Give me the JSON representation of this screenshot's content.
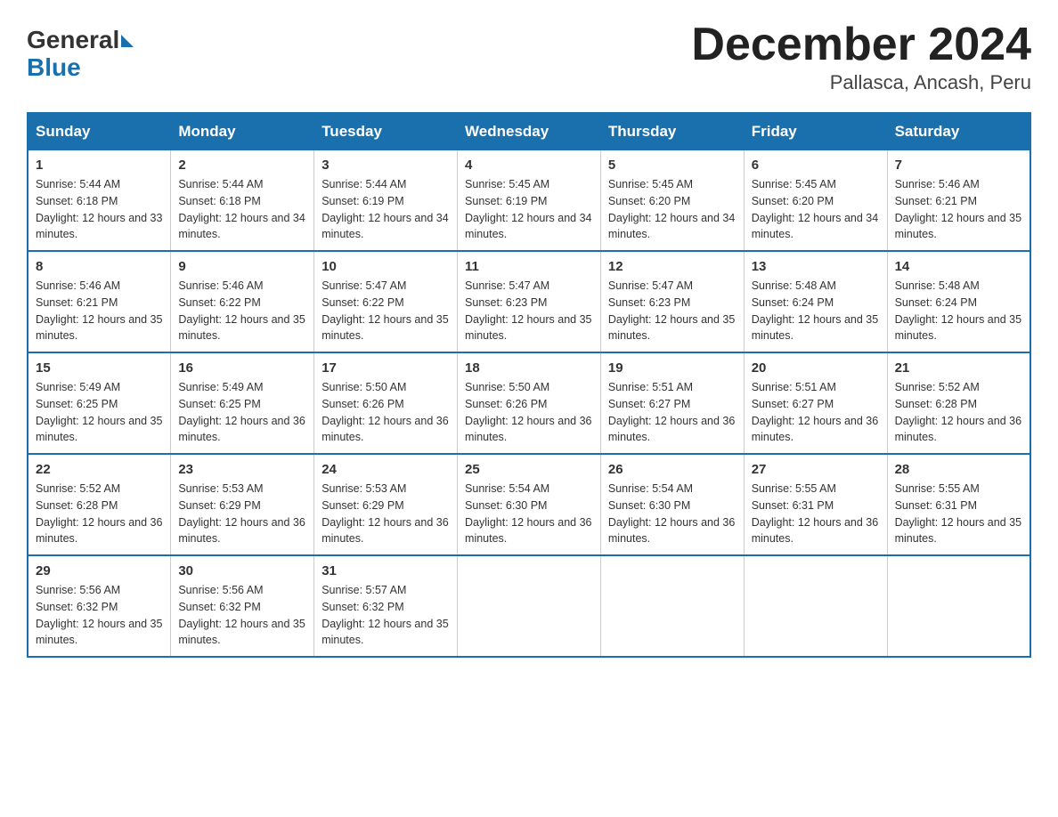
{
  "header": {
    "title": "December 2024",
    "subtitle": "Pallasca, Ancash, Peru"
  },
  "logo": {
    "general": "General",
    "blue": "Blue"
  },
  "days_of_week": [
    "Sunday",
    "Monday",
    "Tuesday",
    "Wednesday",
    "Thursday",
    "Friday",
    "Saturday"
  ],
  "weeks": [
    [
      {
        "day": "1",
        "sunrise": "5:44 AM",
        "sunset": "6:18 PM",
        "daylight": "12 hours and 33 minutes."
      },
      {
        "day": "2",
        "sunrise": "5:44 AM",
        "sunset": "6:18 PM",
        "daylight": "12 hours and 34 minutes."
      },
      {
        "day": "3",
        "sunrise": "5:44 AM",
        "sunset": "6:19 PM",
        "daylight": "12 hours and 34 minutes."
      },
      {
        "day": "4",
        "sunrise": "5:45 AM",
        "sunset": "6:19 PM",
        "daylight": "12 hours and 34 minutes."
      },
      {
        "day": "5",
        "sunrise": "5:45 AM",
        "sunset": "6:20 PM",
        "daylight": "12 hours and 34 minutes."
      },
      {
        "day": "6",
        "sunrise": "5:45 AM",
        "sunset": "6:20 PM",
        "daylight": "12 hours and 34 minutes."
      },
      {
        "day": "7",
        "sunrise": "5:46 AM",
        "sunset": "6:21 PM",
        "daylight": "12 hours and 35 minutes."
      }
    ],
    [
      {
        "day": "8",
        "sunrise": "5:46 AM",
        "sunset": "6:21 PM",
        "daylight": "12 hours and 35 minutes."
      },
      {
        "day": "9",
        "sunrise": "5:46 AM",
        "sunset": "6:22 PM",
        "daylight": "12 hours and 35 minutes."
      },
      {
        "day": "10",
        "sunrise": "5:47 AM",
        "sunset": "6:22 PM",
        "daylight": "12 hours and 35 minutes."
      },
      {
        "day": "11",
        "sunrise": "5:47 AM",
        "sunset": "6:23 PM",
        "daylight": "12 hours and 35 minutes."
      },
      {
        "day": "12",
        "sunrise": "5:47 AM",
        "sunset": "6:23 PM",
        "daylight": "12 hours and 35 minutes."
      },
      {
        "day": "13",
        "sunrise": "5:48 AM",
        "sunset": "6:24 PM",
        "daylight": "12 hours and 35 minutes."
      },
      {
        "day": "14",
        "sunrise": "5:48 AM",
        "sunset": "6:24 PM",
        "daylight": "12 hours and 35 minutes."
      }
    ],
    [
      {
        "day": "15",
        "sunrise": "5:49 AM",
        "sunset": "6:25 PM",
        "daylight": "12 hours and 35 minutes."
      },
      {
        "day": "16",
        "sunrise": "5:49 AM",
        "sunset": "6:25 PM",
        "daylight": "12 hours and 36 minutes."
      },
      {
        "day": "17",
        "sunrise": "5:50 AM",
        "sunset": "6:26 PM",
        "daylight": "12 hours and 36 minutes."
      },
      {
        "day": "18",
        "sunrise": "5:50 AM",
        "sunset": "6:26 PM",
        "daylight": "12 hours and 36 minutes."
      },
      {
        "day": "19",
        "sunrise": "5:51 AM",
        "sunset": "6:27 PM",
        "daylight": "12 hours and 36 minutes."
      },
      {
        "day": "20",
        "sunrise": "5:51 AM",
        "sunset": "6:27 PM",
        "daylight": "12 hours and 36 minutes."
      },
      {
        "day": "21",
        "sunrise": "5:52 AM",
        "sunset": "6:28 PM",
        "daylight": "12 hours and 36 minutes."
      }
    ],
    [
      {
        "day": "22",
        "sunrise": "5:52 AM",
        "sunset": "6:28 PM",
        "daylight": "12 hours and 36 minutes."
      },
      {
        "day": "23",
        "sunrise": "5:53 AM",
        "sunset": "6:29 PM",
        "daylight": "12 hours and 36 minutes."
      },
      {
        "day": "24",
        "sunrise": "5:53 AM",
        "sunset": "6:29 PM",
        "daylight": "12 hours and 36 minutes."
      },
      {
        "day": "25",
        "sunrise": "5:54 AM",
        "sunset": "6:30 PM",
        "daylight": "12 hours and 36 minutes."
      },
      {
        "day": "26",
        "sunrise": "5:54 AM",
        "sunset": "6:30 PM",
        "daylight": "12 hours and 36 minutes."
      },
      {
        "day": "27",
        "sunrise": "5:55 AM",
        "sunset": "6:31 PM",
        "daylight": "12 hours and 36 minutes."
      },
      {
        "day": "28",
        "sunrise": "5:55 AM",
        "sunset": "6:31 PM",
        "daylight": "12 hours and 35 minutes."
      }
    ],
    [
      {
        "day": "29",
        "sunrise": "5:56 AM",
        "sunset": "6:32 PM",
        "daylight": "12 hours and 35 minutes."
      },
      {
        "day": "30",
        "sunrise": "5:56 AM",
        "sunset": "6:32 PM",
        "daylight": "12 hours and 35 minutes."
      },
      {
        "day": "31",
        "sunrise": "5:57 AM",
        "sunset": "6:32 PM",
        "daylight": "12 hours and 35 minutes."
      },
      null,
      null,
      null,
      null
    ]
  ]
}
